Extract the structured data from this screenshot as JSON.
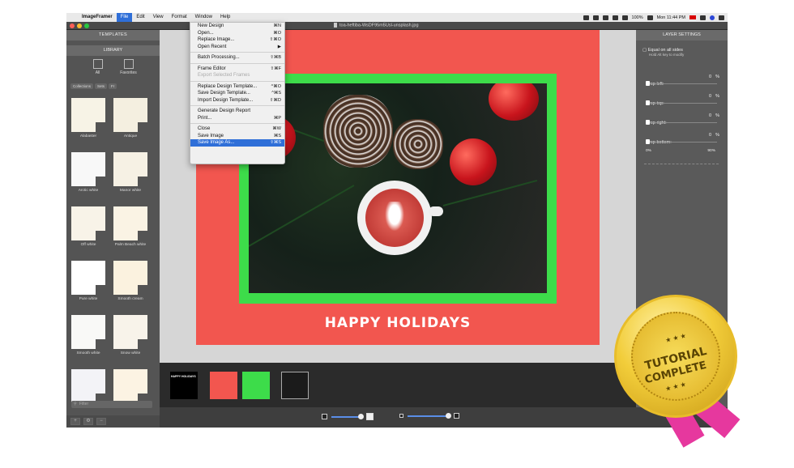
{
  "menubar": {
    "app_name": "ImageFramer",
    "menus": [
      "File",
      "Edit",
      "View",
      "Format",
      "Window",
      "Help"
    ],
    "battery": "100%",
    "clock": "Mon 11:44 PM"
  },
  "window": {
    "title": "toa-heftiba-WsDF95m5Usl-unsplash.jpg"
  },
  "left_panel": {
    "templates_header": "TEMPLATES",
    "library_header": "LIBRARY",
    "buttons": [
      "All",
      "Favorites"
    ],
    "tabs": [
      "Collections",
      "Sets",
      "Fr"
    ],
    "thumbs": [
      {
        "label": "Alabaster",
        "color": "#f7f3e6"
      },
      {
        "label": "Antique",
        "color": "#f4efe0"
      },
      {
        "label": "Arctic white",
        "color": "#f8f8f8"
      },
      {
        "label": "Manor white",
        "color": "#f6f1e4"
      },
      {
        "label": "Off white",
        "color": "#f8f3e8"
      },
      {
        "label": "Palm Beach white",
        "color": "#faf3e4"
      },
      {
        "label": "Pure white",
        "color": "#ffffff"
      },
      {
        "label": "Smooth cream",
        "color": "#fbf2df"
      },
      {
        "label": "Smooth white",
        "color": "#f9f9f7"
      },
      {
        "label": "Snow white",
        "color": "#f8f3ea"
      },
      {
        "label": "",
        "color": "#f3f3f7"
      },
      {
        "label": "",
        "color": "#fcf3e3"
      }
    ],
    "filter_placeholder": "Filter"
  },
  "file_menu": {
    "items": [
      {
        "label": "New Design",
        "shortcut": "⌘N"
      },
      {
        "label": "Open...",
        "shortcut": "⌘O"
      },
      {
        "label": "Replace Image...",
        "shortcut": "⇧⌘O"
      },
      {
        "label": "Open Recent",
        "shortcut": "▶"
      },
      {
        "label": "Batch Processing...",
        "shortcut": "⇧⌘B"
      },
      {
        "label": "Frame Editor",
        "shortcut": "⇧⌘F"
      },
      {
        "label": "Export Selected Frames",
        "shortcut": ""
      },
      {
        "label": "Replace Design Template...",
        "shortcut": "^⌘O"
      },
      {
        "label": "Save Design Template...",
        "shortcut": "^⌘S"
      },
      {
        "label": "Import Design Template...",
        "shortcut": "⇧⌘D"
      },
      {
        "label": "Generate Design Report",
        "shortcut": ""
      },
      {
        "label": "Print...",
        "shortcut": "⌘P"
      },
      {
        "label": "Close",
        "shortcut": "⌘W"
      },
      {
        "label": "Save Image",
        "shortcut": "⌘S"
      },
      {
        "label": "Save Image As...",
        "shortcut": "⇧⌘S"
      }
    ]
  },
  "canvas": {
    "frame_color": "#f2564f",
    "border_color": "#3ddc4a",
    "caption": "HAPPY HOLIDAYS"
  },
  "filmstrip": {
    "items": [
      {
        "kind": "text-layer",
        "label": "HAPPY HOLIDAYS",
        "color": "#000000"
      },
      {
        "kind": "frame-layer",
        "label": "",
        "color": "#f2564f"
      },
      {
        "kind": "border-layer",
        "label": "",
        "color": "#3ddc4a"
      },
      {
        "kind": "photo-layer",
        "label": "",
        "color": "#1b1b1b"
      }
    ]
  },
  "layer_settings": {
    "header": "LAYER SETTINGS",
    "equal_label": "Equal on all sides",
    "equal_hint": "Hold Alt key to modify",
    "crops": [
      {
        "label": "Crop left:",
        "value": "0",
        "unit": "%"
      },
      {
        "label": "Crop top:",
        "value": "0",
        "unit": "%"
      },
      {
        "label": "Crop right:",
        "value": "0",
        "unit": "%"
      },
      {
        "label": "Crop bottom:",
        "value": "0",
        "unit": "%"
      }
    ],
    "range_min": "0%",
    "range_max": "90%"
  },
  "badge": {
    "line1": "TUTORIAL",
    "line2": "COMPLETE"
  }
}
